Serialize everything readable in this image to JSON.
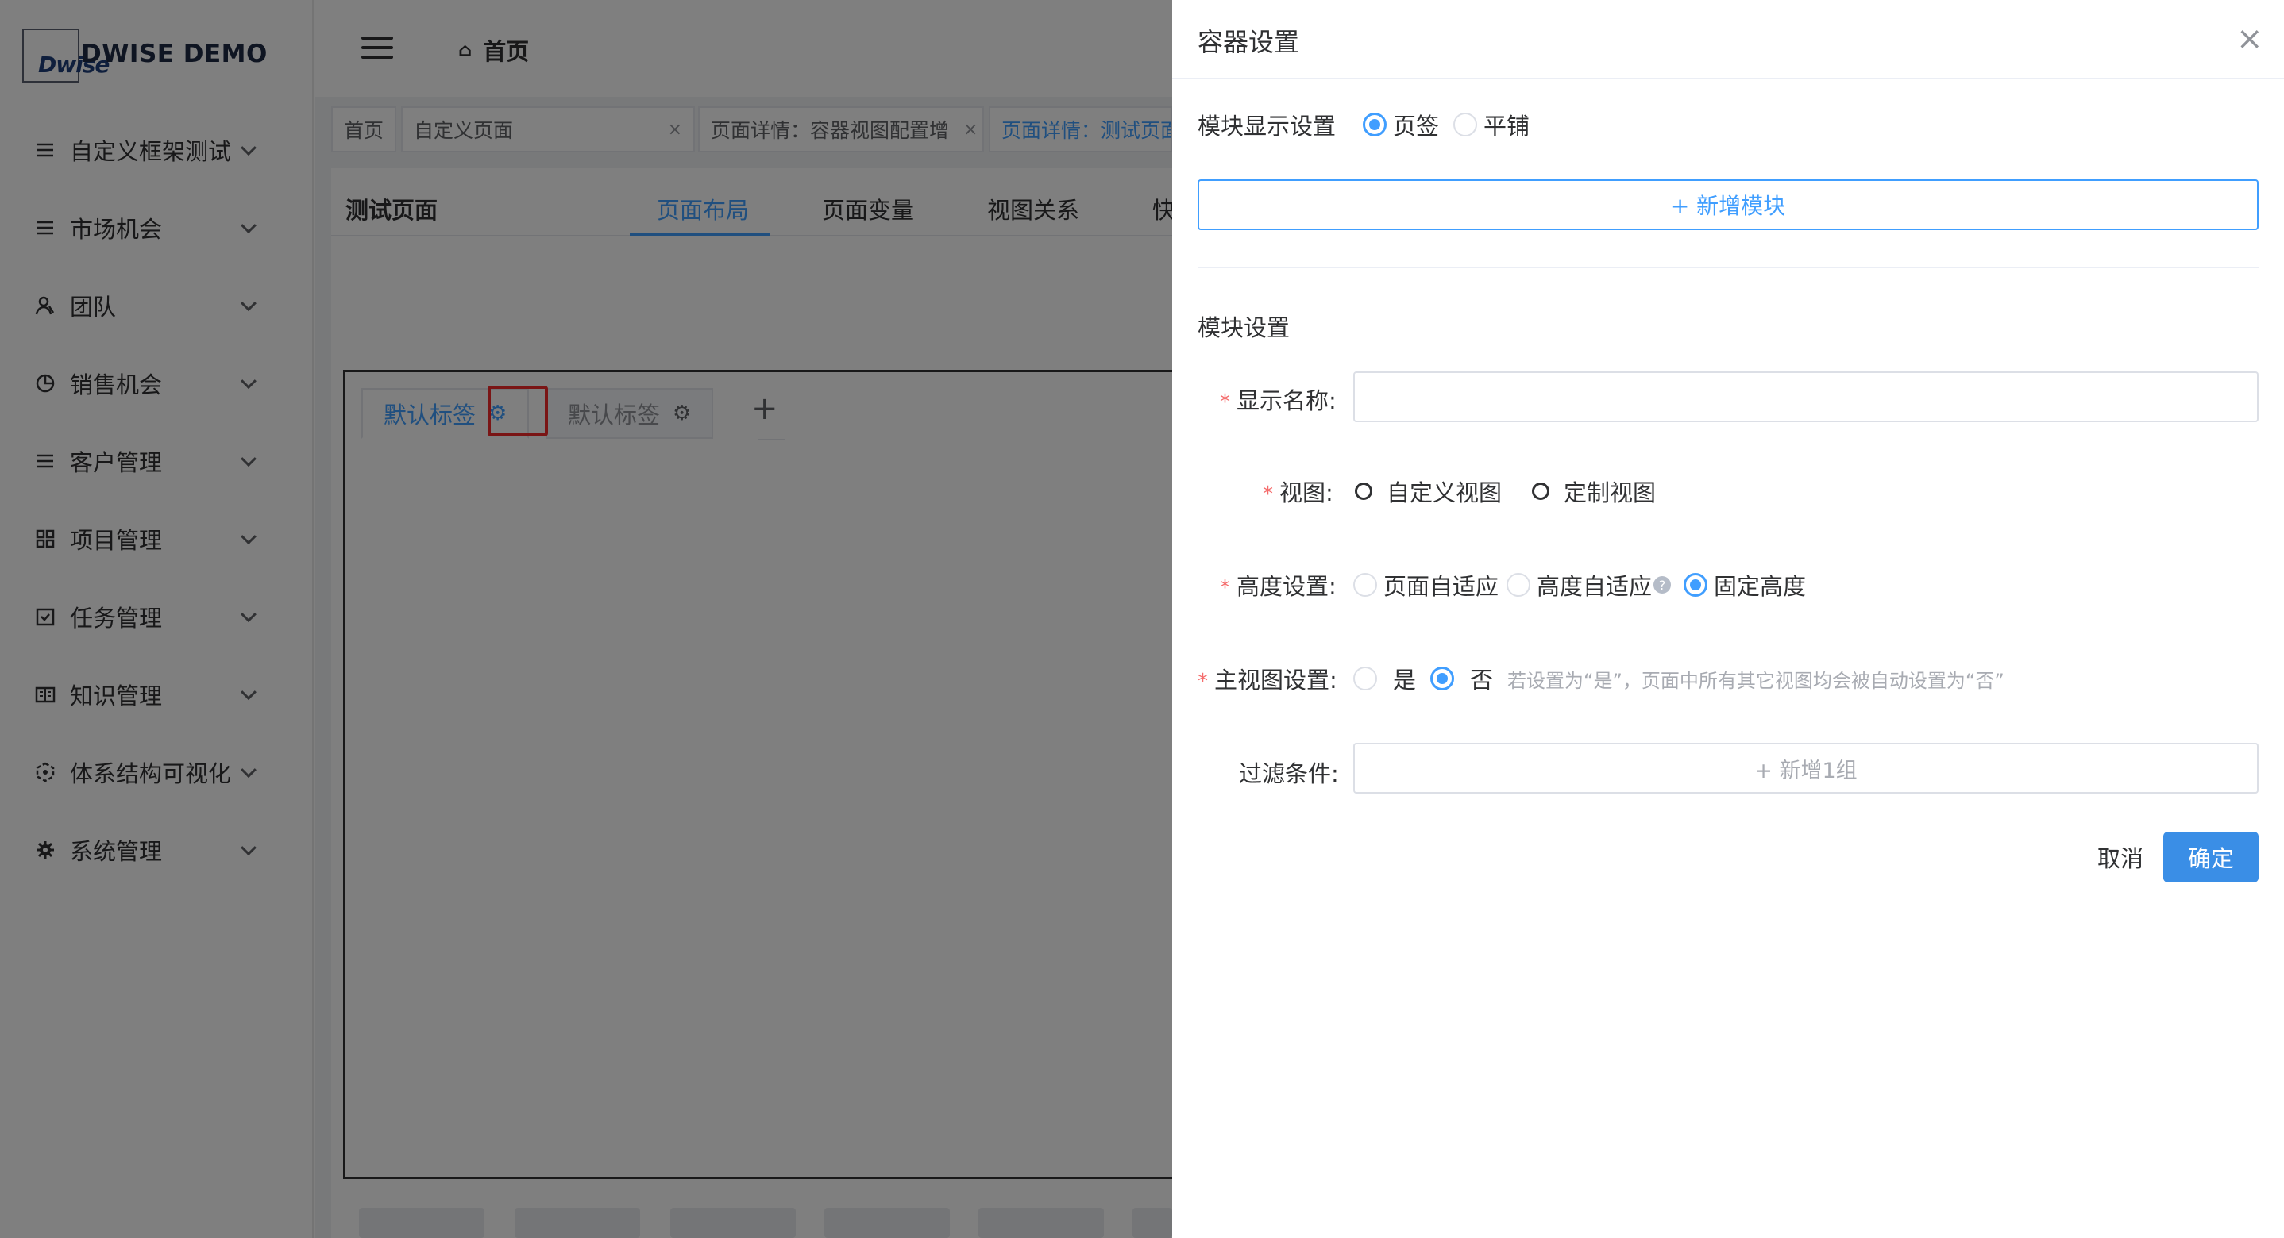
{
  "app": {
    "logo_mark": "Dwise",
    "logo_text": "DWISE DEMO"
  },
  "sidebar": {
    "items": [
      {
        "label": "自定义框架测试",
        "icon": "menu-lines-icon"
      },
      {
        "label": "市场机会",
        "icon": "menu-lines-icon"
      },
      {
        "label": "团队",
        "icon": "team-icon"
      },
      {
        "label": "销售机会",
        "icon": "pie-chart-icon"
      },
      {
        "label": "客户管理",
        "icon": "menu-lines-icon"
      },
      {
        "label": "项目管理",
        "icon": "grid-icon"
      },
      {
        "label": "任务管理",
        "icon": "checkbox-icon"
      },
      {
        "label": "知识管理",
        "icon": "book-icon"
      },
      {
        "label": "体系结构可视化",
        "icon": "hexagon-icon"
      },
      {
        "label": "系统管理",
        "icon": "gear-icon"
      }
    ]
  },
  "header": {
    "breadcrumb": "首页"
  },
  "tags": {
    "home": "首页",
    "custom_page": "自定义页面",
    "detail_container": "页面详情：容器视图配置增",
    "detail_test": "页面详情：测试页面",
    "close_glyph": "×"
  },
  "page": {
    "title": "测试页面",
    "tabs": [
      "页面布局",
      "页面变量",
      "视图关系",
      "快"
    ]
  },
  "canvas": {
    "tab1": "默认标签",
    "tab2": "默认标签",
    "add_glyph": "+"
  },
  "drawer": {
    "title": "容器设置",
    "close_glyph": "×",
    "display_setting_label": "模块显示设置",
    "display_options": [
      "页签",
      "平铺"
    ],
    "display_selected": "页签",
    "add_module_button": "+ 新增模块",
    "module_section_title": "模块设置",
    "display_name_label": "显示名称:",
    "display_name_value": "",
    "view_label": "视图:",
    "view_options": [
      "自定义视图",
      "定制视图"
    ],
    "height_label": "高度设置:",
    "height_options": [
      "页面自适应",
      "高度自适应",
      "固定高度"
    ],
    "height_selected": "固定高度",
    "help_glyph": "?",
    "main_view_label": "主视图设置:",
    "main_view_options": [
      "是",
      "否"
    ],
    "main_view_selected": "否",
    "main_view_hint": "若设置为“是”，页面中所有其它视图均会被自动设置为“否”",
    "filter_label": "过滤条件:",
    "filter_add": "+ 新增1组",
    "required_mark": "*",
    "cancel_button": "取消",
    "ok_button": "确定"
  },
  "colors": {
    "primary": "#409eff",
    "danger": "#f56c6c",
    "highlight": "#f52b2b"
  }
}
